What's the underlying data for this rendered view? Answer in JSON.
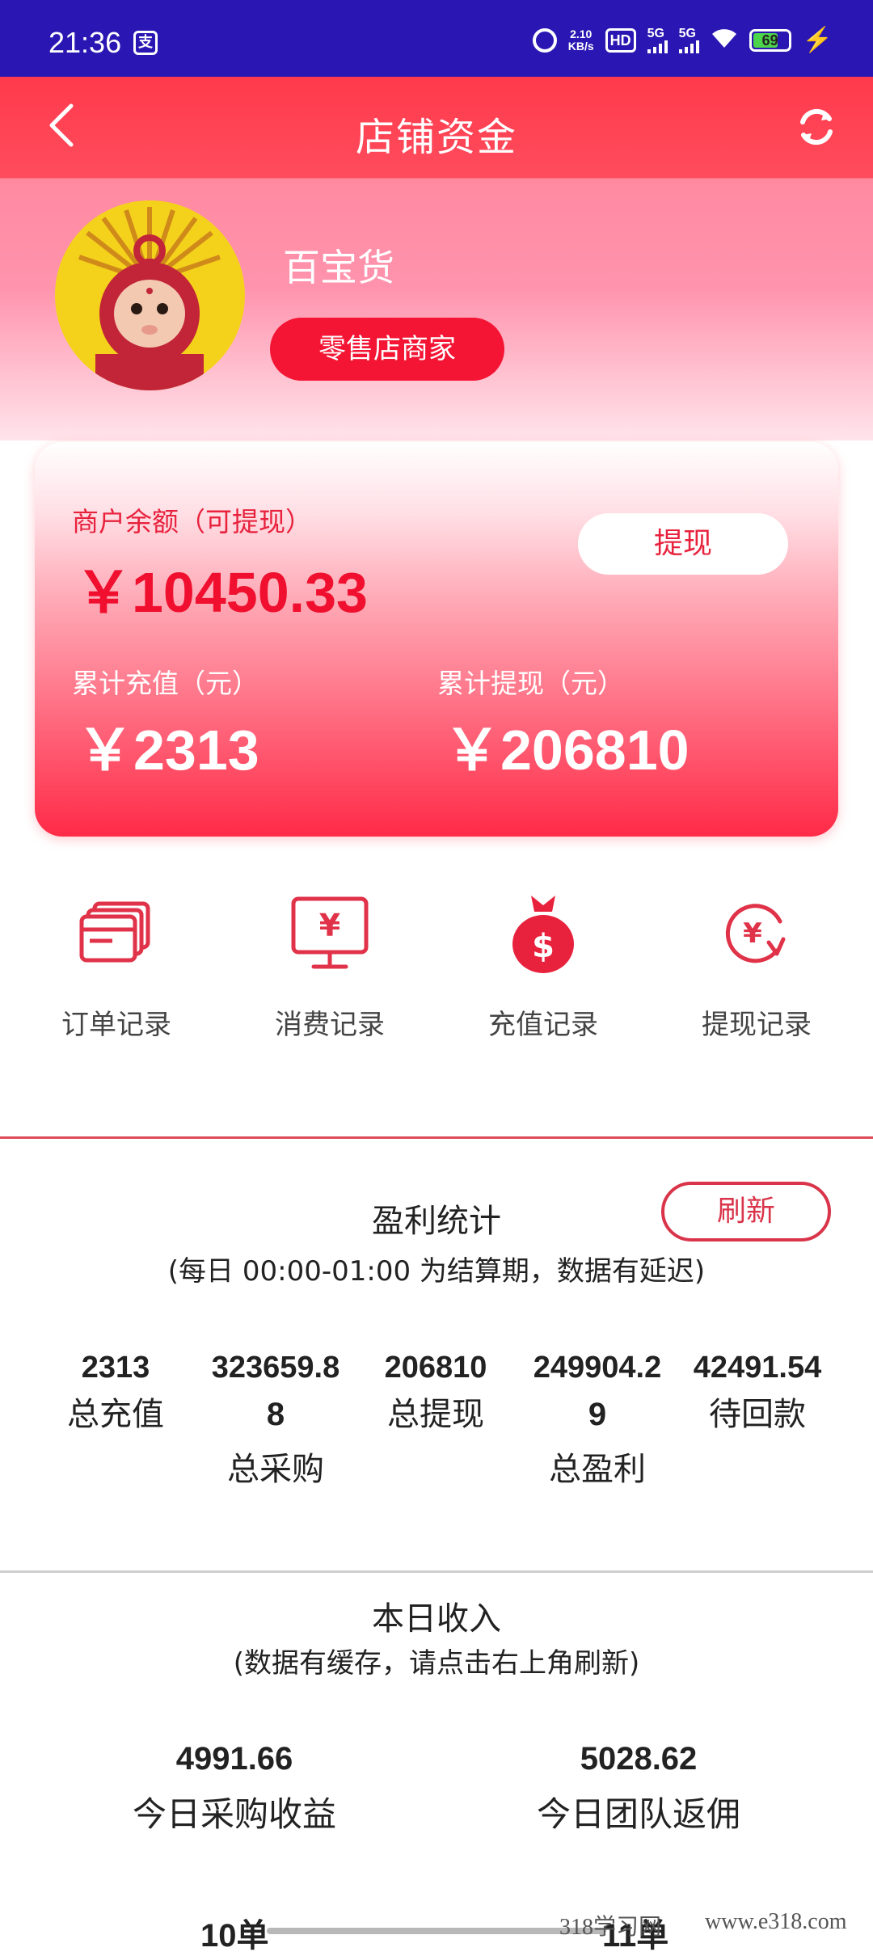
{
  "status_bar": {
    "time": "21:36",
    "carrier_icon": "支",
    "net_speed_value": "2.10",
    "net_speed_unit": "KB/s",
    "hd_label": "HD",
    "sim1_label": "5G",
    "sim2_label": "5G",
    "battery_level": "69",
    "battery_fraction": 0.69
  },
  "nav": {
    "title": "店铺资金"
  },
  "profile": {
    "name": "百宝货",
    "badge": "零售店商家"
  },
  "balance": {
    "label": "商户余额（可提现）",
    "value": "￥10450.33",
    "withdraw_label": "提现",
    "recharge_label": "累计充值（元）",
    "recharge_value": "￥2313",
    "withdrawn_label": "累计提现（元）",
    "withdrawn_value": "￥206810"
  },
  "actions": [
    {
      "label": "订单记录",
      "icon": "cards-icon"
    },
    {
      "label": "消费记录",
      "icon": "monitor-yen-icon"
    },
    {
      "label": "充值记录",
      "icon": "money-bag-icon"
    },
    {
      "label": "提现记录",
      "icon": "yen-exchange-icon"
    }
  ],
  "profit": {
    "title": "盈利统计",
    "refresh_label": "刷新",
    "note": "(每日 00:00-01:00 为结算期，数据有延迟)",
    "stats": [
      {
        "value": "2313",
        "name": "总充值"
      },
      {
        "value_line1": "323659.8",
        "value_line2": "8",
        "name": "总采购"
      },
      {
        "value": "206810",
        "name": "总提现"
      },
      {
        "value_line1": "249904.2",
        "value_line2": "9",
        "name": "总盈利"
      },
      {
        "value": "42491.54",
        "name": "待回款"
      }
    ]
  },
  "today": {
    "title": "本日收入",
    "note": "(数据有缓存，请点击右上角刷新)",
    "items": [
      {
        "value": "4991.66",
        "name": "今日采购收益"
      },
      {
        "value": "5028.62",
        "name": "今日团队返佣"
      }
    ],
    "partial_left": "10单",
    "partial_right": "11单"
  },
  "watermark": {
    "left": "318学习网",
    "right": "www.e318.com"
  },
  "colors": {
    "status_bar": "#2a17b3",
    "accent_red": "#f41534",
    "text_red": "#e8223d"
  }
}
